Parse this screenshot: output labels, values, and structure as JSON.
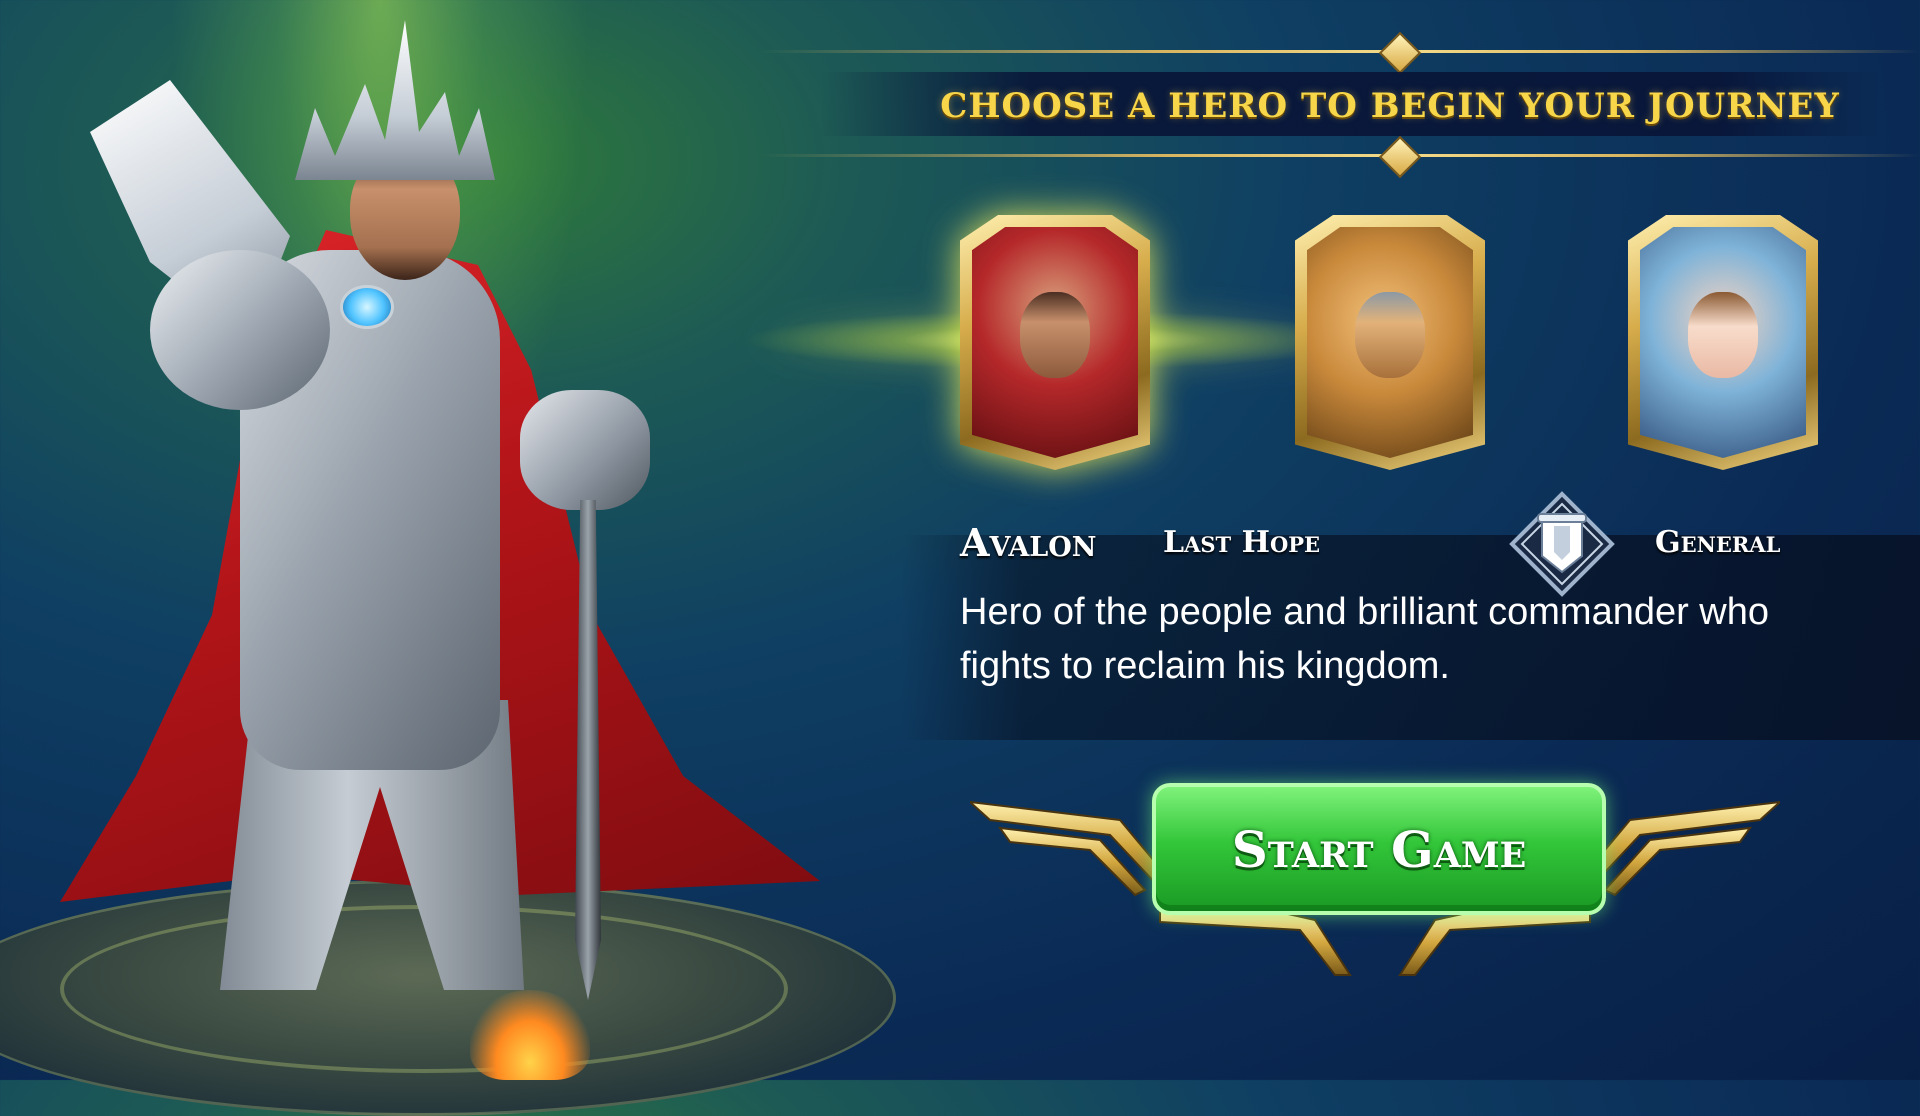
{
  "header": {
    "title": "CHOOSE A HERO TO BEGIN YOUR JOURNEY"
  },
  "heroes": [
    {
      "name": "Avalon",
      "selected": true
    },
    {
      "name": "",
      "selected": false
    },
    {
      "name": "",
      "selected": false
    }
  ],
  "selected_hero": {
    "name": "Avalon",
    "title": "Last Hope",
    "class": "General",
    "class_icon": "shield-banner-icon",
    "description": "Hero of the people and brilliant commander who fights to reclaim his kingdom."
  },
  "actions": {
    "start_label": "Start Game"
  },
  "colors": {
    "title_gold": "#f7d64a",
    "button_green": "#33c63a",
    "cape_red": "#b01418",
    "background_navy": "#0a2a55"
  }
}
